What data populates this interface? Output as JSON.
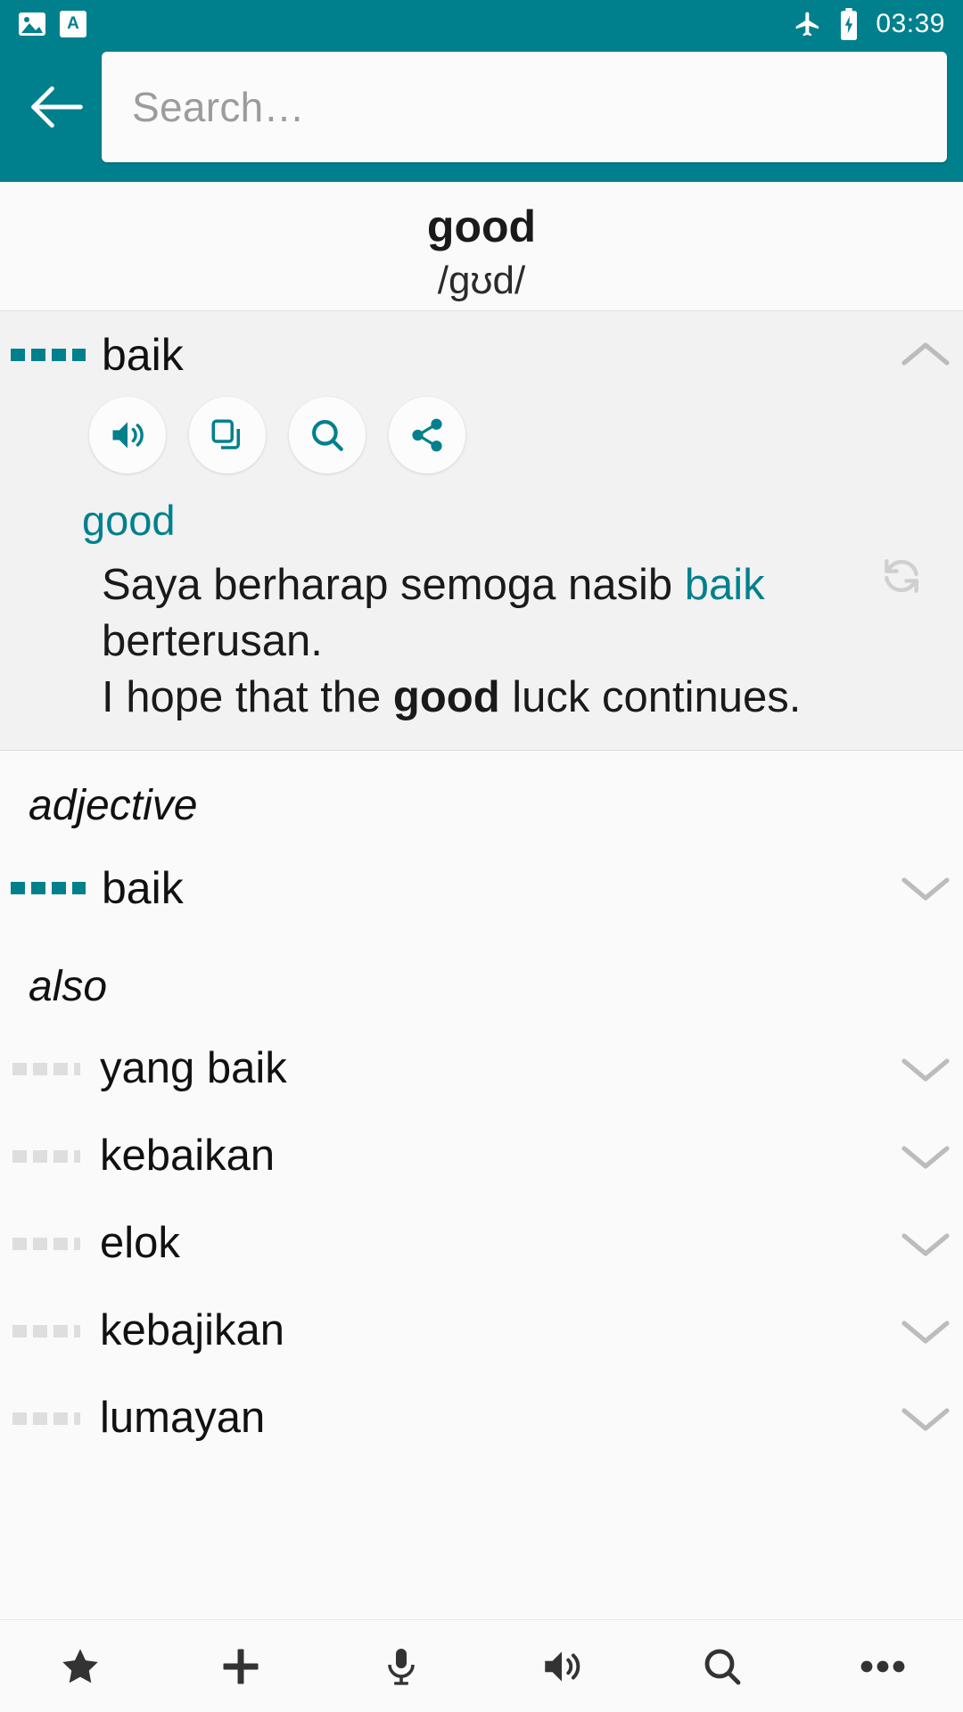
{
  "status_bar": {
    "left_icons": [
      "image-icon",
      "app-icon"
    ],
    "app_icon_letter": "A",
    "right_icons": [
      "airplane-mode-icon",
      "battery-charging-icon"
    ],
    "time": "03:39"
  },
  "app_bar": {
    "back_icon": "back-arrow-icon",
    "search_placeholder": "Search…"
  },
  "entry": {
    "headword": "good",
    "phonetic": "/ɡʊd/"
  },
  "expanded_entry": {
    "term": "baik",
    "collapse_icon": "chevron-up-icon",
    "actions": [
      {
        "name": "speak-button",
        "icon": "speaker-icon"
      },
      {
        "name": "copy-button",
        "icon": "copy-icon"
      },
      {
        "name": "search-button",
        "icon": "magnifier-icon"
      },
      {
        "name": "share-button",
        "icon": "share-icon"
      }
    ],
    "sense_word": "good",
    "example": {
      "source_prefix": "Saya berharap semoga nasib ",
      "source_highlight": "baik",
      "source_suffix": " berterusan.",
      "target_prefix": "I hope that the ",
      "target_bold": "good",
      "target_suffix": " luck continues."
    },
    "refresh_icon": "refresh-icon"
  },
  "sections": [
    {
      "label": "adjective",
      "items": [
        {
          "term": "baik",
          "marker": "teal",
          "chevron": "chevron-down-icon"
        }
      ]
    },
    {
      "label": "also",
      "items": [
        {
          "term": "yang baik",
          "marker": "grey",
          "chevron": "chevron-down-icon"
        },
        {
          "term": "kebaikan",
          "marker": "grey",
          "chevron": "chevron-down-icon"
        },
        {
          "term": "elok",
          "marker": "grey",
          "chevron": "chevron-down-icon"
        },
        {
          "term": "kebajikan",
          "marker": "grey",
          "chevron": "chevron-down-icon"
        },
        {
          "term": "lumayan",
          "marker": "grey",
          "chevron": "chevron-down-icon"
        }
      ]
    }
  ],
  "bottom_bar": [
    {
      "name": "favorites-button",
      "icon": "star-icon"
    },
    {
      "name": "add-button",
      "icon": "plus-icon"
    },
    {
      "name": "microphone-button",
      "icon": "microphone-icon"
    },
    {
      "name": "speaker-button",
      "icon": "speaker-icon"
    },
    {
      "name": "search-button",
      "icon": "magnifier-icon"
    },
    {
      "name": "more-button",
      "icon": "overflow-dots-icon"
    }
  ],
  "colors": {
    "accent": "#00808d",
    "card_bg": "#f2f2f2",
    "page_bg": "#fafafa"
  }
}
